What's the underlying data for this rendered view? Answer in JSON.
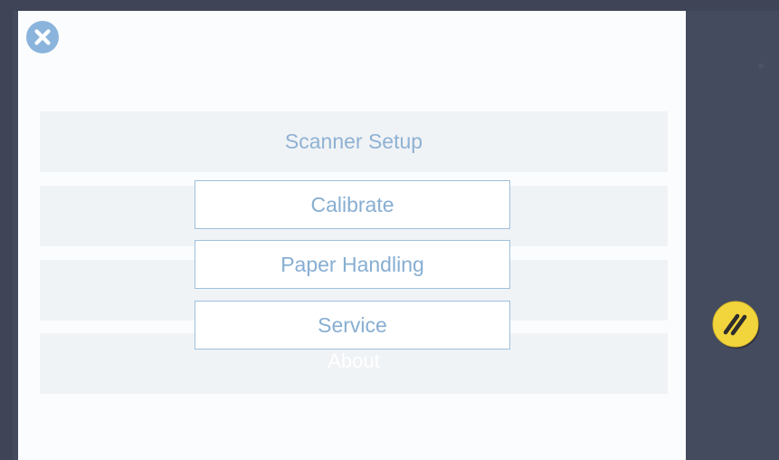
{
  "menu": {
    "items": [
      {
        "label": "Scanner Setup"
      },
      {
        "label": ""
      },
      {
        "label": ""
      },
      {
        "label": "About"
      }
    ]
  },
  "popup": {
    "options": [
      {
        "label": "Calibrate"
      },
      {
        "label": "Paper Handling"
      },
      {
        "label": "Service"
      }
    ]
  },
  "icons": {
    "close": "close-icon",
    "edit": "pencil-icon"
  },
  "colors": {
    "accent": "#8fb2d3",
    "edit_button": "#f2d53c",
    "background": "#454b5e"
  }
}
